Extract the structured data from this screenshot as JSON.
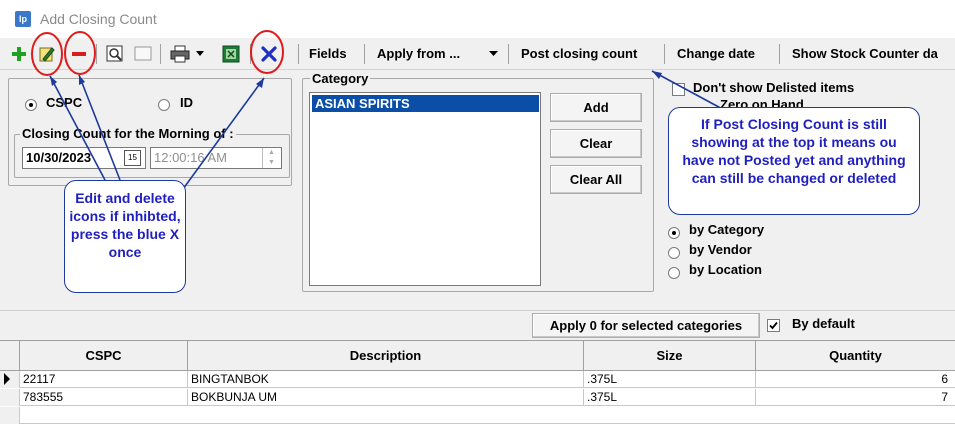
{
  "window": {
    "title": "Add Closing Count",
    "app_icon": "lp"
  },
  "toolbar": {
    "icons": [
      "add-icon",
      "edit-icon",
      "delete-icon",
      "preview-icon",
      "blank-icon",
      "print-icon",
      "dropdown-icon",
      "excel-icon",
      "cancel-x-icon"
    ],
    "fields_label": "Fields",
    "apply_from_label": "Apply from ...",
    "post_label": "Post closing count",
    "change_date_label": "Change date",
    "show_stock_label": "Show Stock Counter da"
  },
  "left_panel": {
    "cspc_label": "CSPC",
    "id_label": "ID",
    "selected_mode": "CSPC",
    "closing_group_label": "Closing Count for the Morning of :",
    "date_value": "10/30/2023",
    "time_value": "12:00:16 AM"
  },
  "category": {
    "group_label": "Category",
    "items": [
      "ASIAN SPIRITS"
    ],
    "add_label": "Add",
    "clear_label": "Clear",
    "clear_all_label": "Clear All"
  },
  "options": {
    "dont_show_delisted": "Don't show Delisted items",
    "zero_on_hand": "Zero on Hand",
    "sort_by_category": "by Category",
    "sort_by_vendor": "by Vendor",
    "sort_by_location": "by Location",
    "selected_sort": "by Category"
  },
  "apply_bar": {
    "apply_label": "Apply 0 for selected categories",
    "by_default_label": "By default",
    "by_default_checked": true
  },
  "grid": {
    "columns": [
      "CSPC",
      "Description",
      "Size",
      "Quantity"
    ],
    "rows": [
      {
        "cspc": "22117",
        "description": "BINGTANBOK",
        "size": ".375L",
        "quantity": "6"
      },
      {
        "cspc": "783555",
        "description": "BOKBUNJA UM",
        "size": ".375L",
        "quantity": "7"
      }
    ]
  },
  "annotations": {
    "callout_left": "Edit and delete icons if inhibted, press the blue X once",
    "callout_right": "If Post Closing Count is still showing at the top it means ou have not Posted yet and anything can still be changed or deleted",
    "callout_color": "#1f1fbf",
    "circle_color": "#e01b1b"
  }
}
